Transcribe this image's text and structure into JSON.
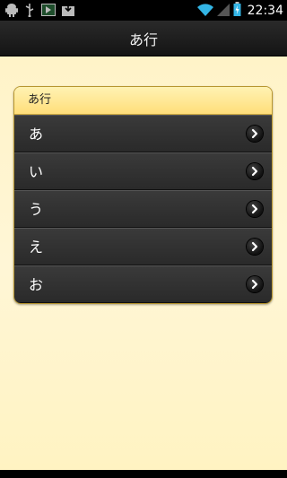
{
  "status_bar": {
    "time": "22:34",
    "icons": [
      "android-icon",
      "usb-icon",
      "media-icon",
      "download-icon",
      "wifi-icon",
      "signal-icon",
      "battery-icon"
    ]
  },
  "action_bar": {
    "title": "あ行"
  },
  "list": {
    "header": "あ行",
    "items": [
      {
        "label": "あ"
      },
      {
        "label": "い"
      },
      {
        "label": "う"
      },
      {
        "label": "え"
      },
      {
        "label": "お"
      }
    ]
  },
  "colors": {
    "background": "#fff3c8",
    "header_yellow": "#ffde7a",
    "row_dark": "#2f2f2f",
    "action_bar": "#1c1c1c"
  }
}
